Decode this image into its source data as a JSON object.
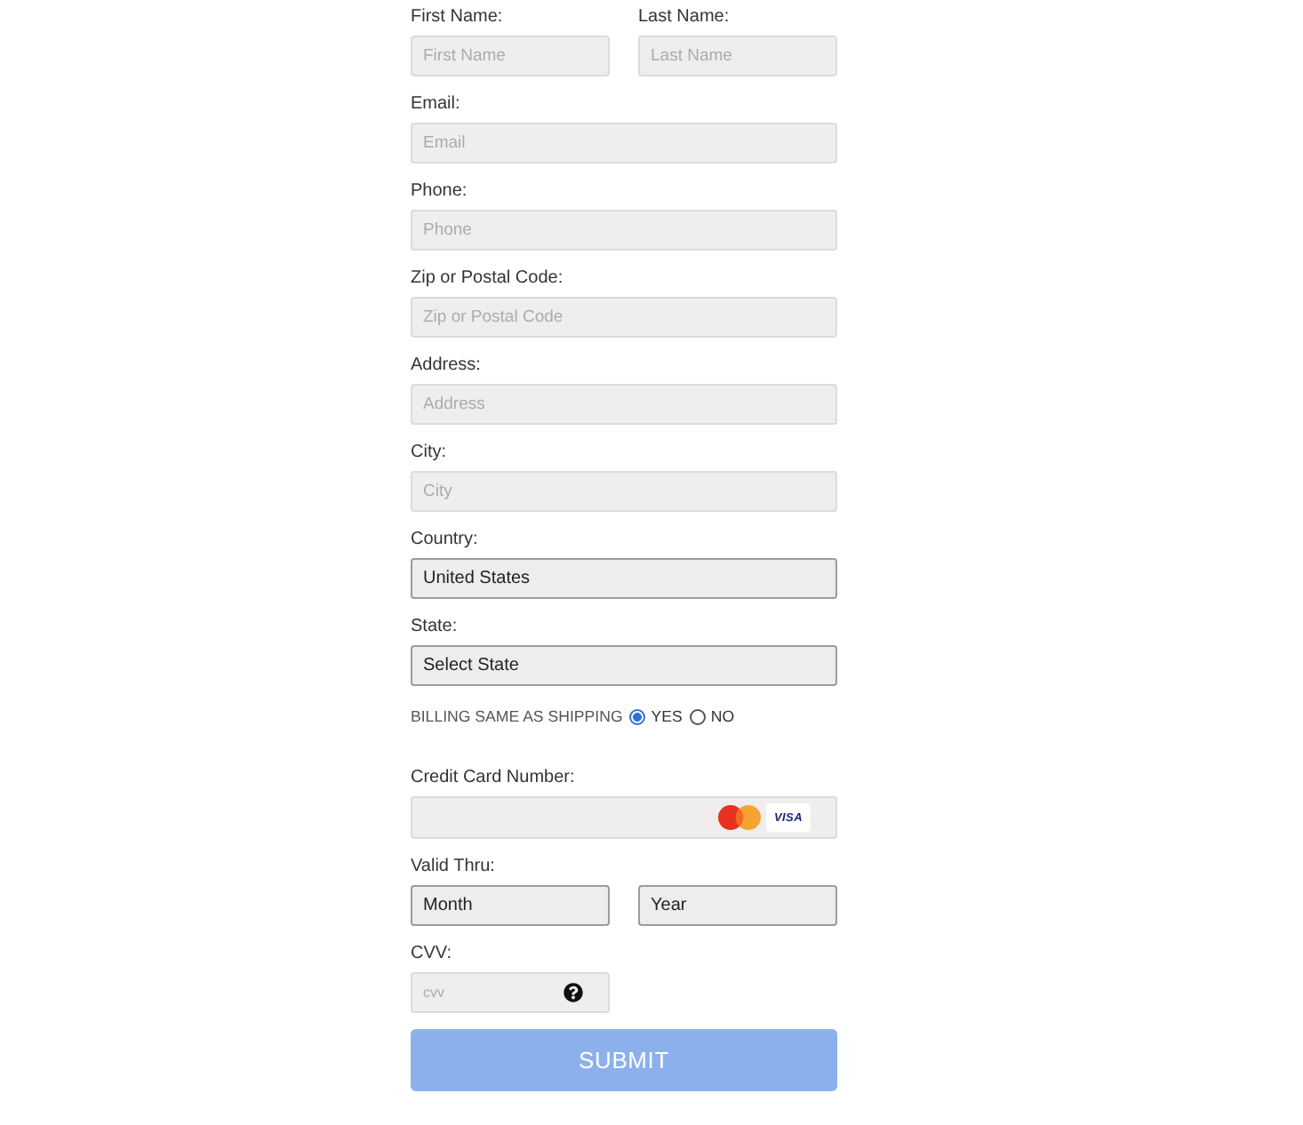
{
  "name_row": [
    {
      "label": "First Name:",
      "placeholder": "First Name"
    },
    {
      "label": "Last Name:",
      "placeholder": "Last Name"
    }
  ],
  "fields": [
    {
      "kind": "input",
      "label": "Email:",
      "placeholder": "Email"
    },
    {
      "kind": "input",
      "label": "Phone:",
      "placeholder": "Phone"
    },
    {
      "kind": "input",
      "label": "Zip or Postal Code:",
      "placeholder": "Zip or Postal Code"
    },
    {
      "kind": "input",
      "label": "Address:",
      "placeholder": "Address"
    },
    {
      "kind": "input",
      "label": "City:",
      "placeholder": "City"
    },
    {
      "kind": "select",
      "label": "Country:",
      "value": "United States"
    },
    {
      "kind": "select",
      "label": "State:",
      "value": "Select State"
    }
  ],
  "billing_same_as_shipping": {
    "label": "BILLING SAME AS SHIPPING",
    "options": [
      {
        "label": "YES",
        "selected": true
      },
      {
        "label": "NO",
        "selected": false
      }
    ]
  },
  "credit_card": {
    "label": "Credit Card Number:",
    "card_logos": [
      {
        "kind": "mastercard"
      },
      {
        "kind": "visa",
        "text": "VISA"
      }
    ]
  },
  "valid_thru": {
    "label": "Valid Thru:",
    "selects": [
      {
        "value": "Month"
      },
      {
        "value": "Year"
      }
    ]
  },
  "cvv": {
    "label": "CVV:",
    "placeholder": "cvv"
  },
  "submit": {
    "label": "SUBMIT",
    "disabled": true
  }
}
